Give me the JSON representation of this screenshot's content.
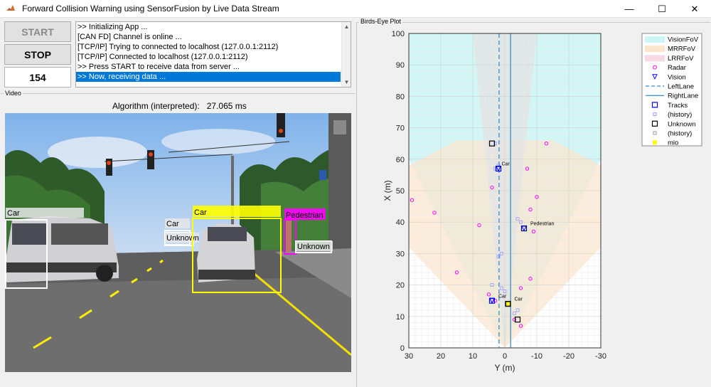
{
  "window": {
    "title": "Forward Collision Warning using SensorFusion by Live Data Stream",
    "minimize": "—",
    "maximize": "☐",
    "close": "✕"
  },
  "controls": {
    "start_label": "START",
    "stop_label": "STOP",
    "counter": "154"
  },
  "log": {
    "lines": [
      ">> Initializing App ...",
      "[CAN FD] Channel is online ...",
      "[TCP/IP] Trying to connected to localhost (127.0.0.1:2112)",
      "[TCP/IP] Connected to localhost (127.0.0.1:2112)",
      ">> Press START to receive data from server ...",
      ">> Now, receiving data ..."
    ],
    "selected_index": 5
  },
  "video_panel": {
    "label": "Video",
    "algorithm_label": "Algorithm (interpreted):",
    "algorithm_time": "27.065 ms",
    "detections": [
      {
        "label": "Car",
        "color": "#ffffff"
      },
      {
        "label": "Car",
        "color": "#ffffff"
      },
      {
        "label": "Unknown",
        "color": "#ffffff"
      },
      {
        "label": "Car",
        "color": "#ffff00"
      },
      {
        "label": "Pedestrian",
        "color": "#ff00ff"
      },
      {
        "label": "Unknown",
        "color": "#ffffff"
      }
    ]
  },
  "bev_panel": {
    "label": "Birds-Eye Plot",
    "ylabel": "X (m)",
    "xlabel": "Y (m)",
    "x_ticks": [
      "30",
      "20",
      "10",
      "0",
      "-10",
      "-20",
      "-30"
    ],
    "y_ticks": [
      "0",
      "10",
      "20",
      "30",
      "40",
      "50",
      "60",
      "70",
      "80",
      "90",
      "100"
    ],
    "legend": [
      {
        "label": "VisionFoV",
        "type": "patch",
        "color": "#ccf5f5"
      },
      {
        "label": "MRRFoV",
        "type": "patch",
        "color": "#fbe6cc"
      },
      {
        "label": "LRRFoV",
        "type": "patch",
        "color": "#f7d9e6"
      },
      {
        "label": "Radar",
        "type": "circle",
        "color": "#ff00ff"
      },
      {
        "label": "Vision",
        "type": "triangle",
        "color": "#0000ff"
      },
      {
        "label": "LeftLane",
        "type": "dashed",
        "color": "#0072bd"
      },
      {
        "label": "RightLane",
        "type": "line",
        "color": "#0072bd"
      },
      {
        "label": "Tracks",
        "type": "square",
        "color": "#0000ff"
      },
      {
        "label": "(history)",
        "type": "smallsquare",
        "color": "#9999ff"
      },
      {
        "label": "Unknown",
        "type": "square",
        "color": "#000000"
      },
      {
        "label": "(history)",
        "type": "smallsquare",
        "color": "#999999"
      },
      {
        "label": "mio",
        "type": "filled",
        "color": "#ffff00"
      }
    ],
    "track_labels": [
      "Car",
      "Pedestrian",
      "Car",
      "Car"
    ],
    "fov_colors": {
      "vision": "#ccf5f5",
      "mrr": "#fbe6cc",
      "lrr": "#f7d9e6"
    }
  }
}
